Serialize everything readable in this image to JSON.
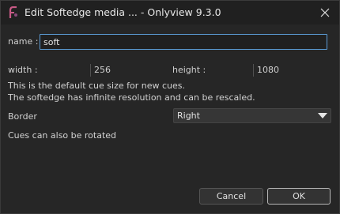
{
  "window": {
    "title": "Edit Softedge media ... - Onlyview  9.3.0",
    "icon": "onlyview-app-icon",
    "close_icon": "close-icon"
  },
  "form": {
    "name_label": "name :",
    "name_value": "soft",
    "width_label": "width :",
    "width_value": "256",
    "height_label": "height :",
    "height_value": "1080",
    "info_line1": "This is the default cue size for new cues.",
    "info_line2": "The softedge has infinite resolution and can be rescaled.",
    "border_label": "Border",
    "border_value": "Right",
    "rotate_note": "Cues can also be rotated"
  },
  "buttons": {
    "cancel": "Cancel",
    "ok": "OK"
  },
  "colors": {
    "accent": "#5b9bd5",
    "background": "#262626",
    "app_icon": "#c85a86"
  }
}
